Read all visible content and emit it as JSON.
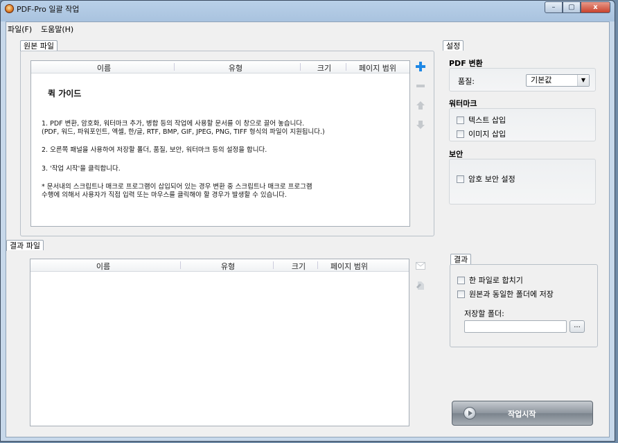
{
  "window": {
    "title": "PDF-Pro 일괄 작업",
    "min": "–",
    "max": "▢",
    "close": "x"
  },
  "menu": {
    "file": "파일(F)",
    "help": "도움말(H)"
  },
  "source": {
    "tab": "원본 파일",
    "columns": {
      "name": "이름",
      "type": "유형",
      "size": "크기",
      "page_range": "페이지 범위"
    },
    "guide": {
      "title": "퀵 가이드",
      "line1a": "1. PDF 변환, 암호화, 워터마크 추가, 병합 등의 작업에 사용할 문서를 이 창으로 끌어 놓습니다.",
      "line1b": "(PDF, 워드, 파워포인트, 엑셀, 한/글, RTF, BMP, GIF, JPEG, PNG, TIFF 형식의 파일이 지원됩니다.)",
      "line2": "2. 오른쪽 패널을 사용하여 저장할 폴더, 품질, 보안, 워터마크 등의 설정을 합니다.",
      "line3": "3. '작업 시작'을 클릭합니다.",
      "line4a": "* 문서내의 스크립트나 매크로 프로그램이 삽입되어 있는 경우 변환 중 스크립트나 매크로 프로그램",
      "line4b": "수행에 의해서 사용자가 직접 입력 또는 마우스를 클릭해야 할 경우가 발생할 수 있습니다."
    },
    "icons": [
      "add-icon",
      "remove-icon",
      "move-up-icon",
      "move-down-icon"
    ]
  },
  "result": {
    "tab": "결과 파일",
    "columns": {
      "name": "이름",
      "type": "유형",
      "size": "크기",
      "page_range": "페이지 범위"
    },
    "icons": [
      "mail-icon",
      "open-file-icon"
    ]
  },
  "settings": {
    "tab": "설정",
    "pdf_title": "PDF 변환",
    "quality_label": "품질:",
    "quality_value": "기본값",
    "watermark_title": "워터마크",
    "text_insert": "텍스트 삽입",
    "image_insert": "이미지 삽입",
    "security_title": "보안",
    "password": "암호 보안 설정"
  },
  "output": {
    "tab": "결과",
    "merge": "한 파일로 합치기",
    "same_folder": "원본과 동일한 폴더에 저장",
    "folder_label": "저장할 폴더:",
    "folder_value": "",
    "browse": "..."
  },
  "start": {
    "label": "작업시작"
  },
  "colors": {
    "add_icon": "#1e88e5",
    "accent": "#b9d0e8"
  }
}
